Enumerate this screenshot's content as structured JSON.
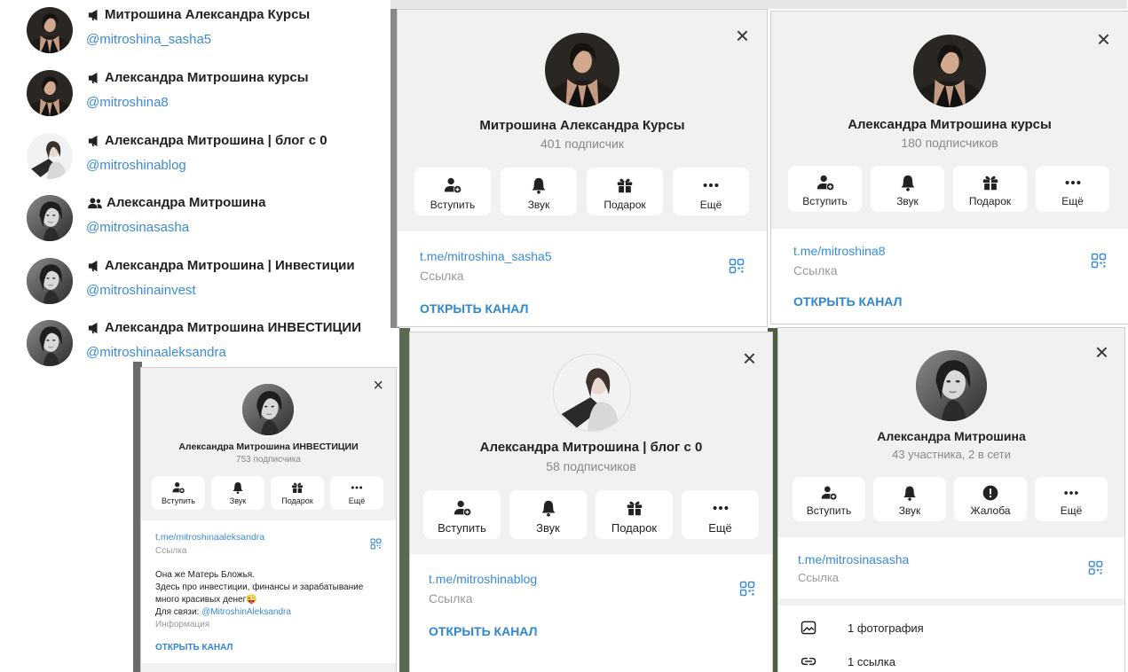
{
  "search_results": [
    {
      "title": "Митрошина Александра Курсы",
      "handle": "@mitroshina_sasha5",
      "type": "channel"
    },
    {
      "title": "Александра Митрошина курсы",
      "handle": "@mitroshina8",
      "type": "channel"
    },
    {
      "title": "Александра Митрошина | блог с 0",
      "handle": "@mitroshinablog",
      "type": "channel"
    },
    {
      "title": "Александра Митрошина",
      "handle": "@mitrosinasasha",
      "type": "group"
    },
    {
      "title": "Александра Митрошина | Инвестиции",
      "handle": "@mitroshinainvest",
      "type": "channel"
    },
    {
      "title": "Александра Митрошина ИНВЕСТИЦИИ",
      "handle": "@mitroshinaaleksandra",
      "type": "channel"
    }
  ],
  "actions": {
    "join": "Вступить",
    "sound": "Звук",
    "gift": "Подарок",
    "more": "Ещё",
    "report": "Жалоба"
  },
  "link_label": "Ссылка",
  "open_channel": "ОТКРЫТЬ КАНАЛ",
  "close_symbol": "×",
  "panels": {
    "sasha5": {
      "name": "Митрошина Александра Курсы",
      "subs": "401 подписчик",
      "link": "t.me/mitroshina_sasha5"
    },
    "m8": {
      "name": "Александра Митрошина курсы",
      "subs": "180 подписчиков",
      "link": "t.me/mitroshina8"
    },
    "invest": {
      "name": "Александра Митрошина ИНВЕСТИЦИИ",
      "subs": "753 подписчика",
      "link": "t.me/mitroshinaaleksandra",
      "desc_line1": "Она же Матерь Бложья.",
      "desc_line2": "Здесь про инвестиции, финансы и зарабатывание",
      "desc_line3": "много красивых денег😜",
      "contact_prefix": "Для связи: ",
      "contact_handle": "@MitroshinAleksandra",
      "info_label": "Информация"
    },
    "blog": {
      "name": "Александра Митрошина | блог с 0",
      "subs": "58 подписчиков",
      "link": "t.me/mitroshinablog"
    },
    "group": {
      "name": "Александра Митрошина",
      "subs": "43 участника, 2 в сети",
      "link": "t.me/mitrosinasasha",
      "photos": "1 фотография",
      "links": "1 ссылка"
    }
  },
  "colors": {
    "accent": "#3a8bd6",
    "header_bg": "#f1f1f1",
    "text_gray": "#888888"
  }
}
